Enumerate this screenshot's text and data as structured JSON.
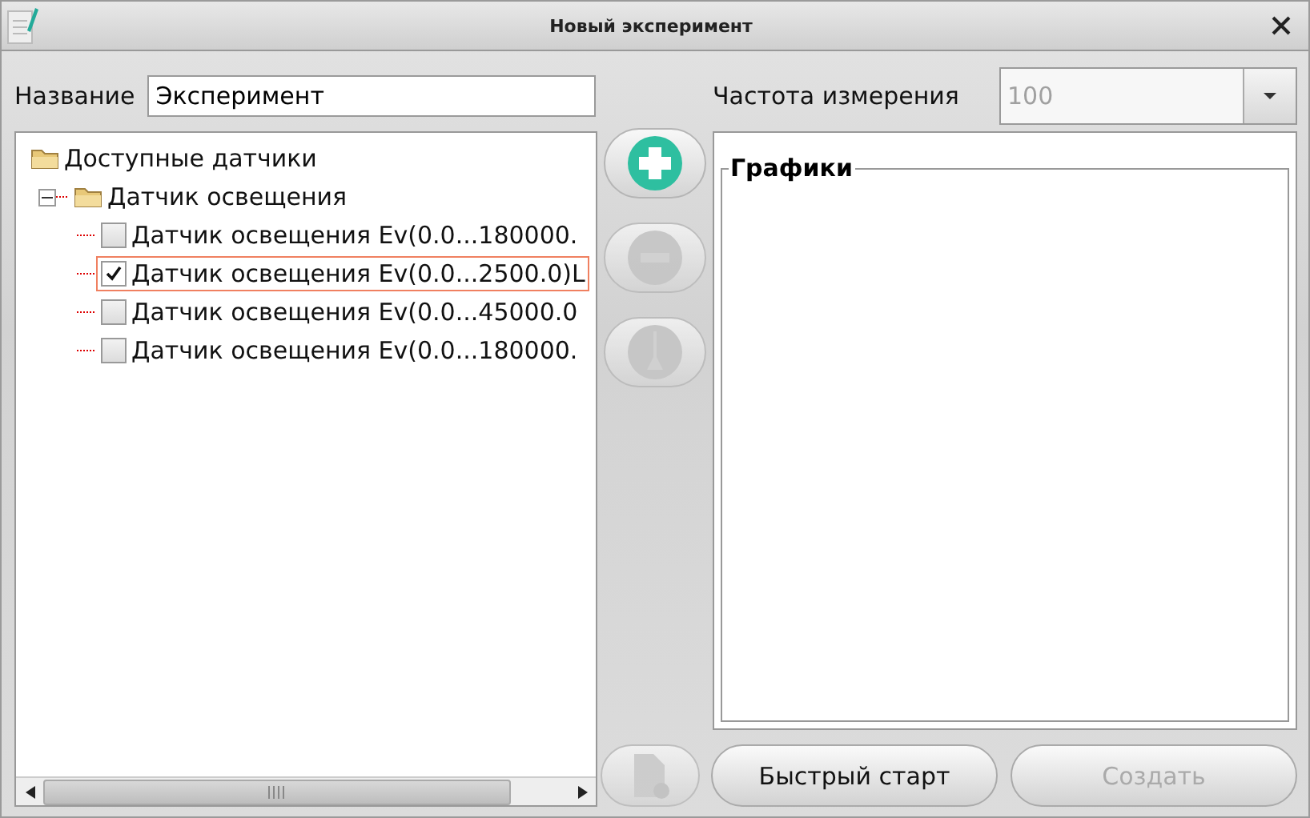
{
  "window": {
    "title": "Новый эксперимент"
  },
  "name_field": {
    "label": "Название",
    "value": "Эксперимент"
  },
  "frequency": {
    "label": "Частота измерения",
    "value": "100",
    "disabled": true
  },
  "tree": [
    {
      "label": "Доступные датчики",
      "children": [
        {
          "label": "Датчик освещения",
          "expanded": true,
          "children": [
            {
              "label": "Датчик освещения Ev(0.0...180000.",
              "checked": false,
              "selected": false
            },
            {
              "label": "Датчик освещения Ev(0.0...2500.0)L",
              "checked": true,
              "selected": true
            },
            {
              "label": "Датчик освещения Ev(0.0...45000.0",
              "checked": false,
              "selected": false
            },
            {
              "label": "Датчик освещения Ev(0.0...180000.",
              "checked": false,
              "selected": false
            }
          ]
        }
      ]
    }
  ],
  "side_buttons": [
    {
      "kind": "add",
      "disabled": false
    },
    {
      "kind": "remove",
      "disabled": true
    },
    {
      "kind": "edit",
      "disabled": true
    }
  ],
  "charts_group": {
    "title": "Графики"
  },
  "bottom_buttons": [
    {
      "kind": "file",
      "disabled": true
    },
    {
      "kind": "text",
      "label": "Быстрый старт",
      "disabled": false
    },
    {
      "kind": "text",
      "label": "Создать",
      "disabled": true
    }
  ]
}
